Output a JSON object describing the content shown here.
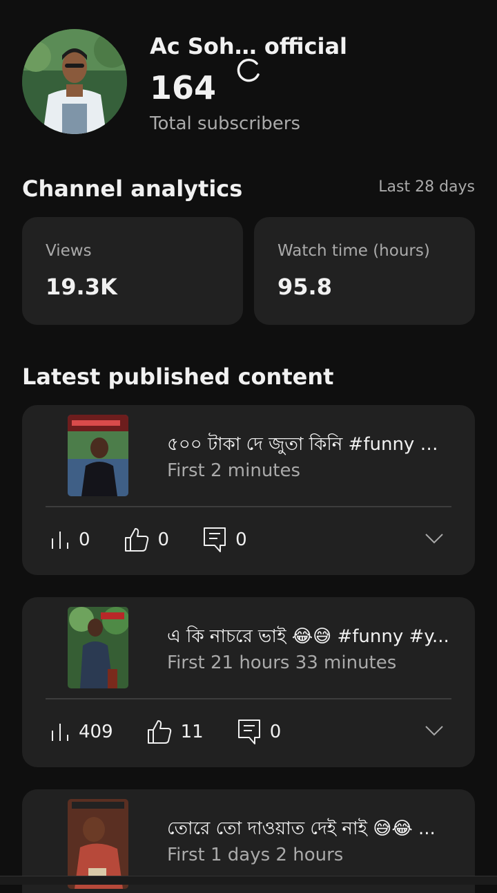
{
  "channel": {
    "name": "Ac Soh… official",
    "subscriber_count": "164",
    "subscriber_label": "Total subscribers"
  },
  "analytics": {
    "title": "Channel analytics",
    "range": "Last 28 days",
    "stats": [
      {
        "label": "Views",
        "value": "19.3K"
      },
      {
        "label": "Watch time (hours)",
        "value": "95.8"
      }
    ]
  },
  "latest": {
    "title": "Latest published content",
    "videos": [
      {
        "title": "৫০০ টাকা দে জুতা কিনি #funny #...",
        "time": "First 2 minutes",
        "views": "0",
        "likes": "0",
        "comments": "0"
      },
      {
        "title": "এ কি নাচরে ভাই 😂😅 #funny #y...",
        "time": "First 21 hours 33 minutes",
        "views": "409",
        "likes": "11",
        "comments": "0"
      },
      {
        "title": "তোরে তো দাওয়াত দেই নাই 😅😂 ...",
        "time": "First 1 days 2 hours"
      }
    ]
  },
  "icons": {
    "views": "bar-chart-icon",
    "likes": "thumbs-up-icon",
    "comments": "comment-icon",
    "expand": "chevron-down-icon",
    "loading": "loading-spinner-icon"
  },
  "colors": {
    "background": "#0f0f0f",
    "card": "#212121",
    "secondary_text": "#aaaaaa"
  }
}
